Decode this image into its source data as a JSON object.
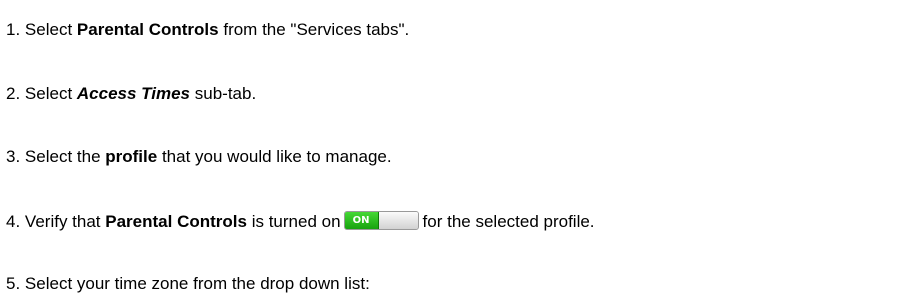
{
  "steps": [
    {
      "number": "1.",
      "text_before": "Select",
      "bold": "Parental Controls",
      "text_after": "from the \"Services tabs\"."
    },
    {
      "number": "2.",
      "text_before": "Select",
      "bold_italic": "Access Times",
      "text_after": "sub-tab."
    },
    {
      "number": "3.",
      "text_before": "Select the",
      "bold": "profile",
      "text_after": "that you would like to manage."
    },
    {
      "number": "4.",
      "text_before": "Verify that",
      "bold": "Parental Controls",
      "text_middle": "is turned on",
      "toggle_label": "ON",
      "text_after": "for the selected profile."
    },
    {
      "number": "5.",
      "text_before": "Select your time zone from the drop down list:"
    }
  ],
  "colors": {
    "toggle_on": "#17a30e",
    "text": "#000000"
  }
}
